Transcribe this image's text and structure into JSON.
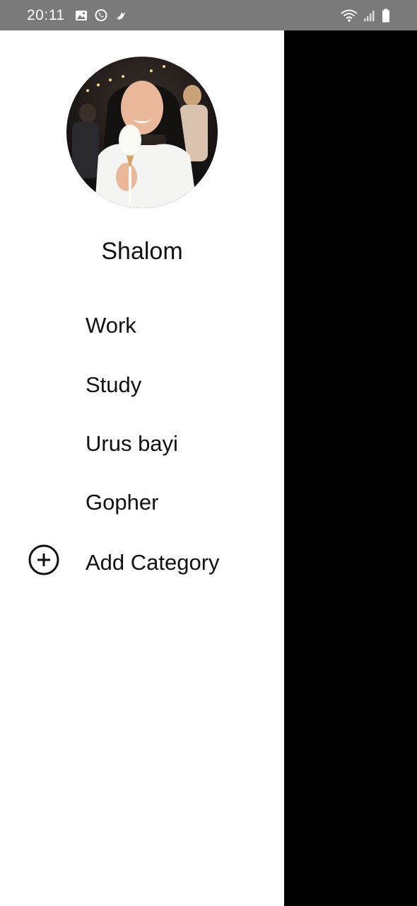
{
  "status_bar": {
    "time": "20:11",
    "left_icons": [
      "gallery-icon",
      "whatsapp-icon",
      "bird-icon"
    ],
    "right_icons": [
      "wifi-icon",
      "signal-icon",
      "battery-icon"
    ]
  },
  "drawer": {
    "profile": {
      "name": "Shalom"
    },
    "categories": [
      {
        "label": "Work"
      },
      {
        "label": "Study"
      },
      {
        "label": "Urus bayi"
      },
      {
        "label": "Gopher"
      }
    ],
    "add_category": {
      "label": "Add Category",
      "icon": "add-circle-icon"
    }
  },
  "colors": {
    "status_bar_bg": "#7a7a7a",
    "drawer_bg": "#ffffff",
    "scrim": "#000000",
    "text": "#111111"
  }
}
